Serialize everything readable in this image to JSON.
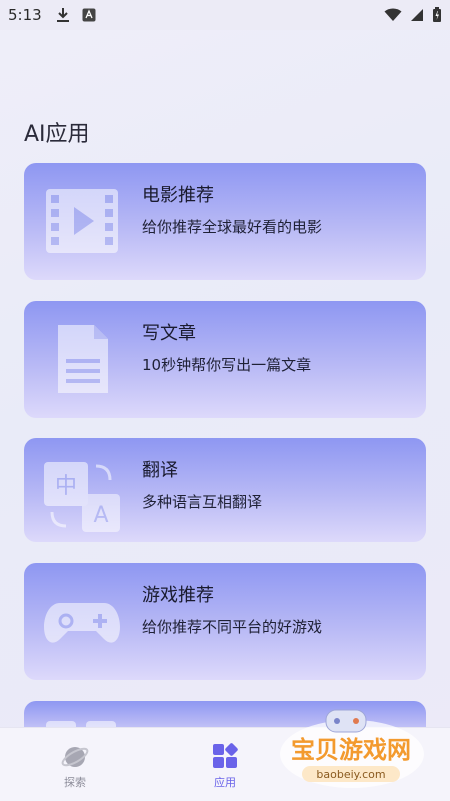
{
  "status_bar": {
    "time": "5:13"
  },
  "page": {
    "title": "AI应用"
  },
  "cards": [
    {
      "title": "电影推荐",
      "desc": "给你推荐全球最好看的电影",
      "icon": "film-icon"
    },
    {
      "title": "写文章",
      "desc": "10秒钟帮你写出一篇文章",
      "icon": "document-icon"
    },
    {
      "title": "翻译",
      "desc": "多种语言互相翻译",
      "icon": "translate-icon"
    },
    {
      "title": "游戏推荐",
      "desc": "给你推荐不同平台的好游戏",
      "icon": "gamepad-icon"
    }
  ],
  "bottom_nav": {
    "items": [
      {
        "label": "探索",
        "icon": "planet-icon",
        "active": false
      },
      {
        "label": "应用",
        "icon": "apps-icon",
        "active": true
      }
    ]
  },
  "watermark": {
    "text": "宝贝游戏网",
    "url": "baobeiy.com"
  },
  "colors": {
    "accent": "#6a63e9",
    "card_top": "#8e97f2",
    "card_bottom": "#ddd9fb",
    "watermark_orange": "#f39a2e"
  }
}
